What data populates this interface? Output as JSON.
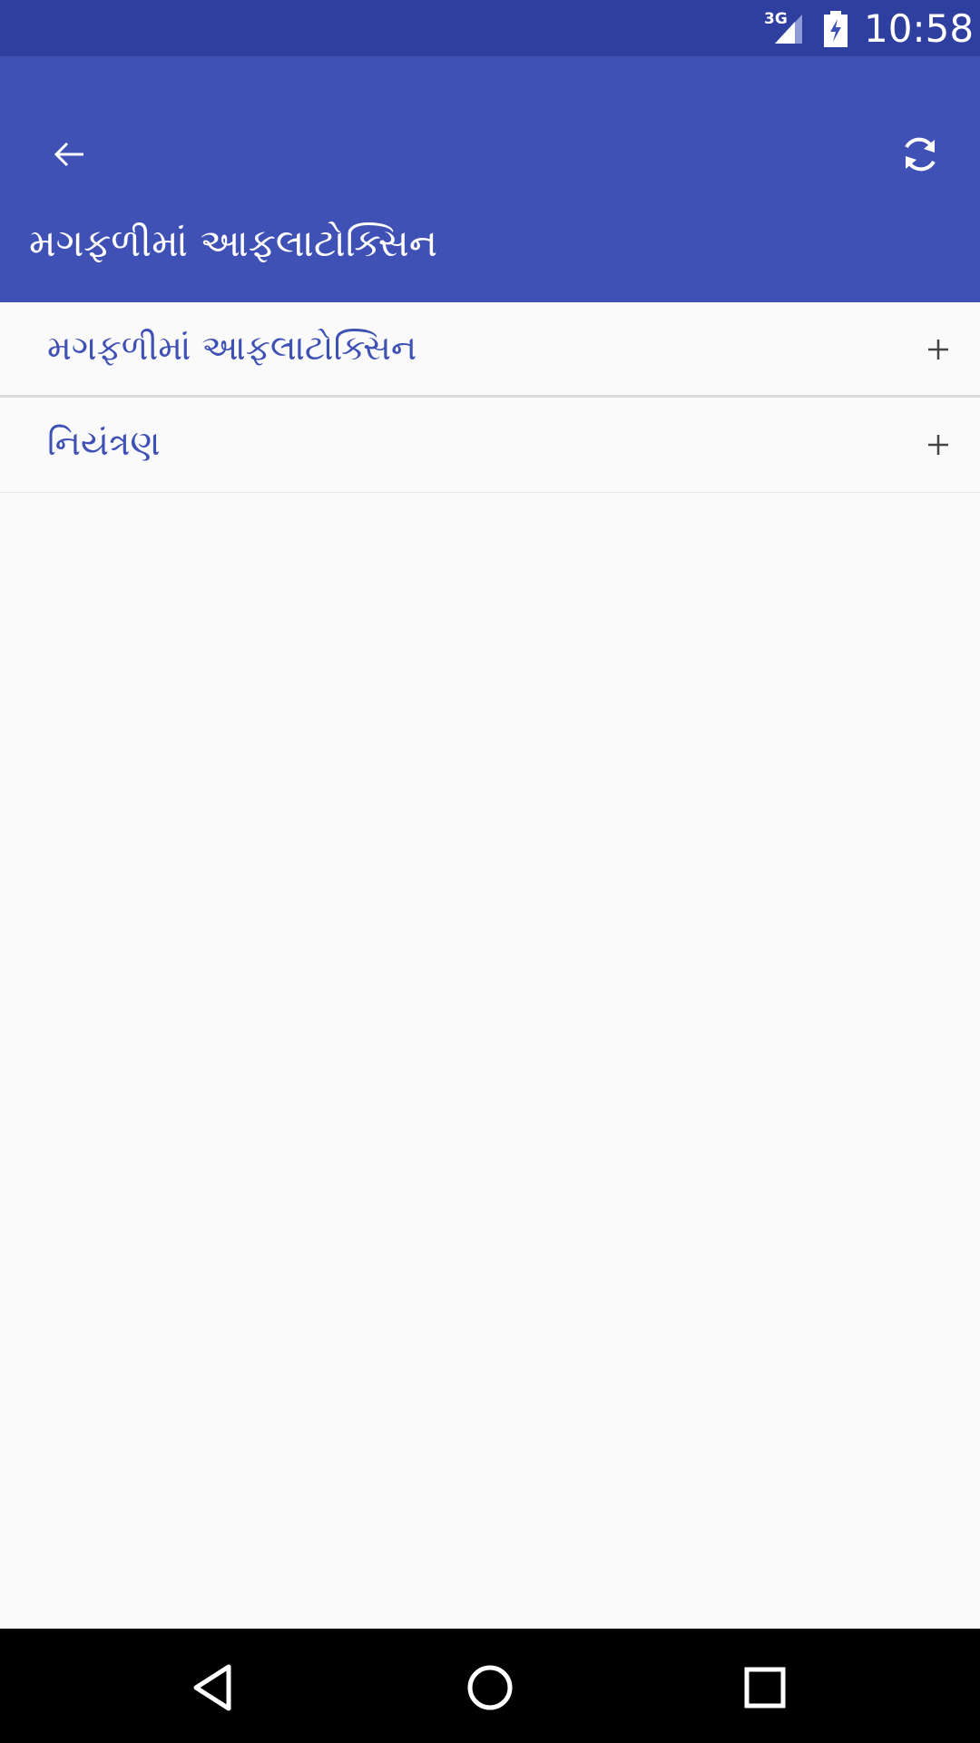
{
  "status_bar": {
    "network": "3G",
    "time": "10:58"
  },
  "toolbar": {
    "title": "મગફળીમાં આફલાટોક્સિન",
    "back_icon": "arrow-back-icon",
    "refresh_icon": "refresh-icon"
  },
  "list": {
    "items": [
      {
        "label": "મગફળીમાં આફલાટોક્સિન",
        "icon": "plus-icon"
      },
      {
        "label": "નિયંત્રણ",
        "icon": "plus-icon"
      }
    ]
  },
  "nav_bar": {
    "back_icon": "nav-back-icon",
    "home_icon": "nav-home-icon",
    "recents_icon": "nav-recents-icon"
  },
  "colors": {
    "status_bar": "#2f3f9f",
    "primary": "#3f51b5",
    "background": "#fafafa",
    "nav_bar": "#000000"
  }
}
